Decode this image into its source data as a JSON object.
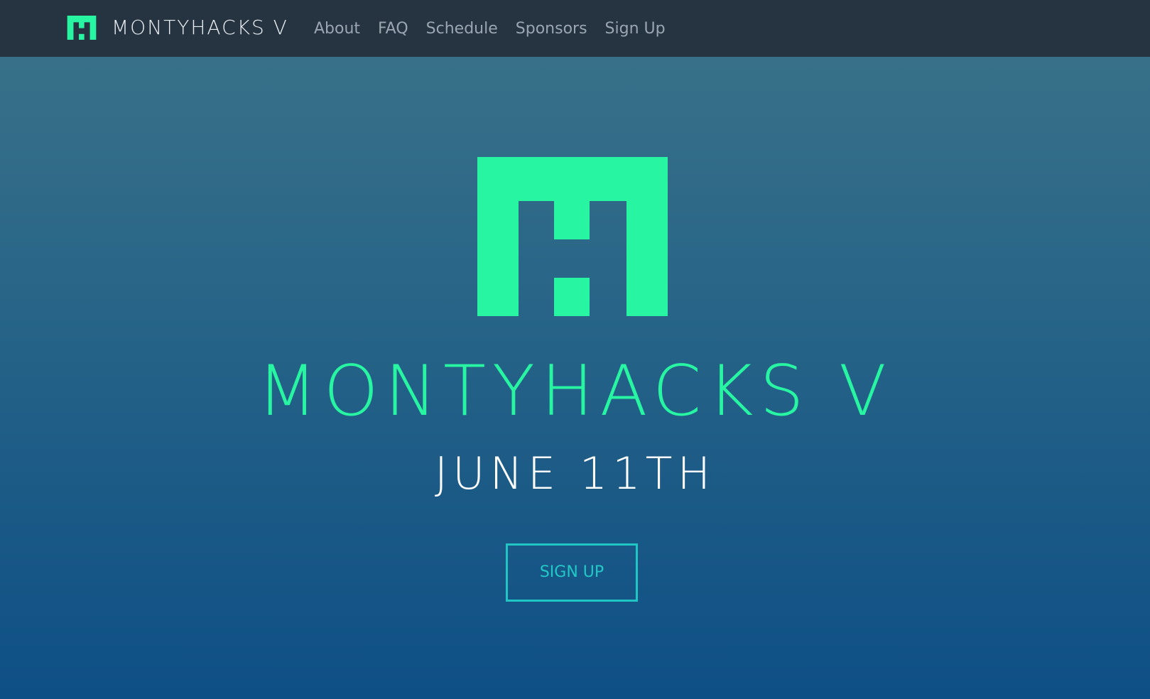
{
  "navbar": {
    "brand_text": "MONTYHACKS V",
    "brand_icon": "montyhacks-logo-icon",
    "links": [
      {
        "label": "About"
      },
      {
        "label": "FAQ"
      },
      {
        "label": "Schedule"
      },
      {
        "label": "Sponsors"
      },
      {
        "label": "Sign Up"
      }
    ]
  },
  "hero": {
    "logo_icon": "montyhacks-logo-icon",
    "title": "MONTYHACKS V",
    "date": "JUNE 11TH",
    "cta_label": "SIGN UP"
  },
  "colors": {
    "navbar_bg": "#263340",
    "accent_green": "#27f5a2",
    "button_teal": "#1fc6c4",
    "gradient_top": "#3b7389",
    "gradient_bottom": "#0e4f86"
  }
}
